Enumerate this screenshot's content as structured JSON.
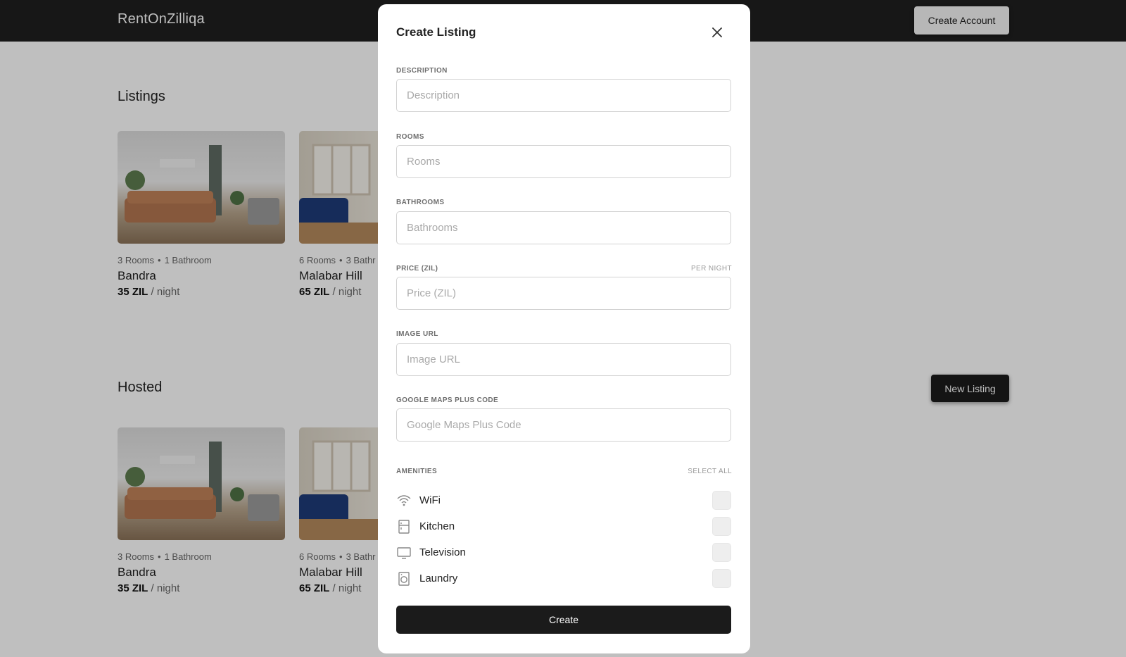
{
  "app": {
    "brand": "RentOnZilliqa",
    "create_account_label": "Create Account"
  },
  "listings": {
    "title": "Listings",
    "cards": [
      {
        "meta_rooms": "3 Rooms",
        "meta_baths": "1 Bathroom",
        "name": "Bandra",
        "price": "35 ZIL",
        "unit": "/ night"
      },
      {
        "meta_rooms": "6 Rooms",
        "meta_baths": "3 Bathr",
        "name": "Malabar Hill",
        "price": "65 ZIL",
        "unit": "/ night"
      }
    ]
  },
  "hosted": {
    "title": "Hosted",
    "new_listing_label": "New Listing",
    "cards": [
      {
        "meta_rooms": "3 Rooms",
        "meta_baths": "1 Bathroom",
        "name": "Bandra",
        "price": "35 ZIL",
        "unit": "/ night"
      },
      {
        "meta_rooms": "6 Rooms",
        "meta_baths": "3 Bathr",
        "name": "Malabar Hill",
        "price": "65 ZIL",
        "unit": "/ night"
      }
    ]
  },
  "modal": {
    "title": "Create Listing",
    "fields": [
      {
        "label": "DESCRIPTION",
        "placeholder": "Description",
        "value": ""
      },
      {
        "label": "ROOMS",
        "placeholder": "Rooms",
        "value": ""
      },
      {
        "label": "BATHROOMS",
        "placeholder": "Bathrooms",
        "value": ""
      },
      {
        "label": "PRICE (ZIL)",
        "label_right": "PER NIGHT",
        "placeholder": "Price (ZIL)",
        "value": ""
      },
      {
        "label": "IMAGE URL",
        "placeholder": "Image URL",
        "value": ""
      },
      {
        "label": "GOOGLE MAPS PLUS CODE",
        "placeholder": "Google Maps Plus Code",
        "value": ""
      }
    ],
    "amenities_label": "AMENITIES",
    "select_all_label": "SELECT ALL",
    "amenities": [
      {
        "label": "WiFi",
        "icon": "wifi-icon",
        "checked": false
      },
      {
        "label": "Kitchen",
        "icon": "kitchen-icon",
        "checked": false
      },
      {
        "label": "Television",
        "icon": "television-icon",
        "checked": false
      },
      {
        "label": "Laundry",
        "icon": "laundry-icon",
        "checked": false
      }
    ],
    "create_label": "Create"
  }
}
